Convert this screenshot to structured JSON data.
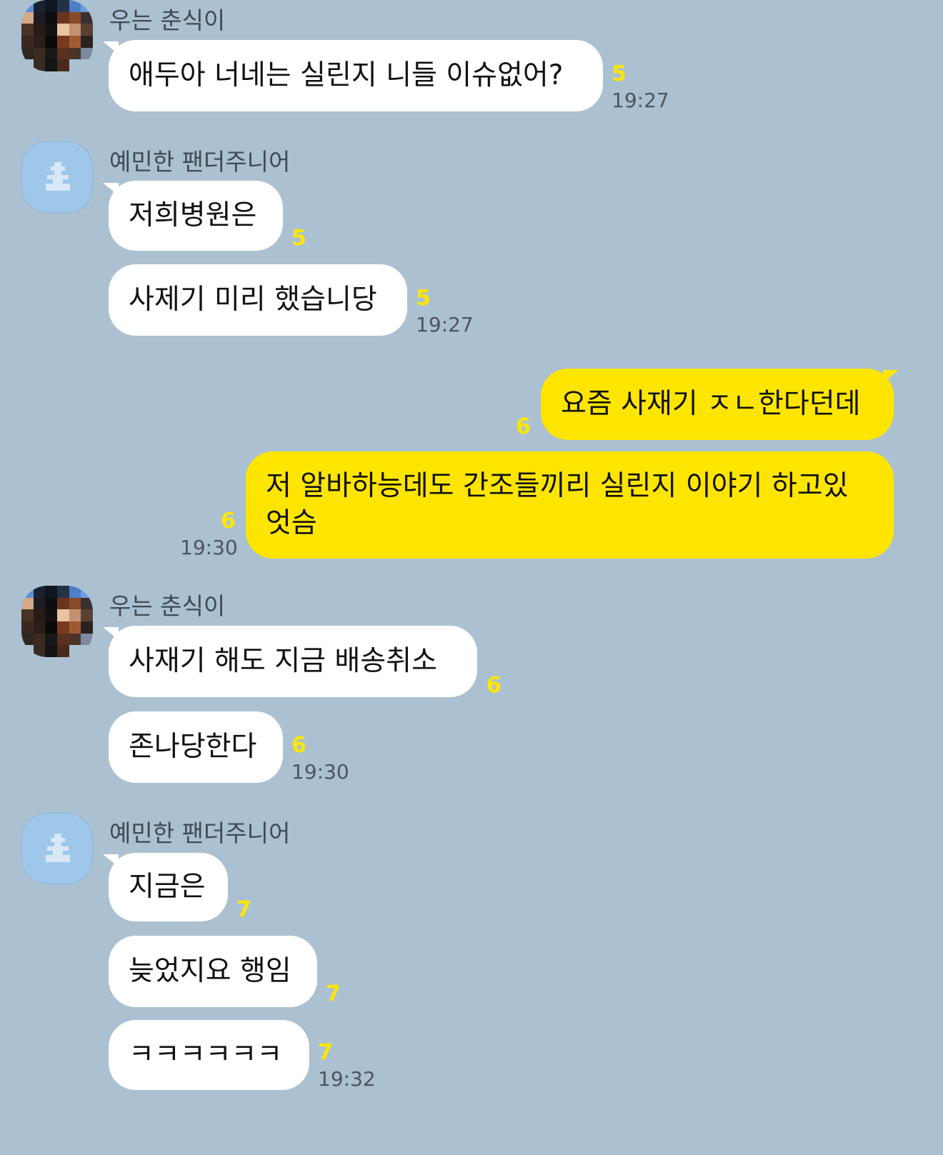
{
  "colors": {
    "background": "#abc1d1",
    "my_bubble": "#fee500",
    "other_bubble": "#ffffff",
    "unread": "#ffe600"
  },
  "senders": {
    "a": "우는 춘식이",
    "b": "예민한 팬더주니어"
  },
  "messages": [
    {
      "text": "애두아 너네는 실린지 니들 이슈없어?",
      "unread": "5",
      "time": "19:27"
    },
    {
      "text": "저희병원은",
      "unread": "5"
    },
    {
      "text": "사제기 미리 했습니당",
      "unread": "5",
      "time": "19:27"
    },
    {
      "text": "요즘 사재기 ㅈㄴ한다던데",
      "unread": "6"
    },
    {
      "line1": "저 알바하능데도 간조들끼리 실린지 이야기 하고있",
      "line2": "엇슴",
      "unread": "6",
      "time": "19:30"
    },
    {
      "text": "사재기 해도  지금 배송취소",
      "unread": "6"
    },
    {
      "text": "존나당한다",
      "unread": "6",
      "time": "19:30"
    },
    {
      "text": "지금은",
      "unread": "7"
    },
    {
      "text": "늦었지요 행임",
      "unread": "7"
    },
    {
      "text": "ㅋㅋㅋㅋㅋㅋ",
      "unread": "7",
      "time": "19:32"
    }
  ]
}
